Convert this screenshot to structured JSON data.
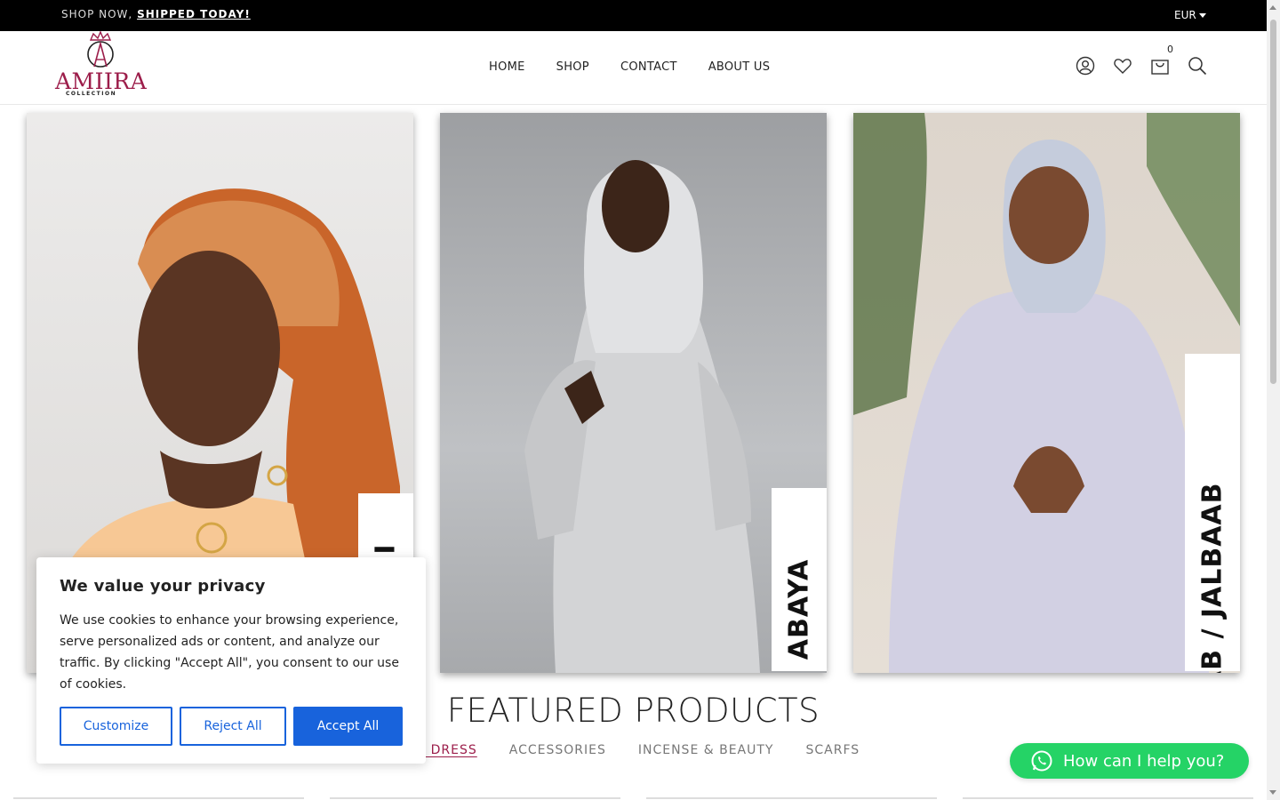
{
  "topbar": {
    "promo_prefix": "SHOP NOW, ",
    "promo_link": "SHIPPED TODAY!",
    "currency": "EUR"
  },
  "logo": {
    "brand": "AMIIRA",
    "sub": "COLLECTION",
    "brand_color": "#9c1d4a"
  },
  "nav": {
    "items": [
      "HOME",
      "SHOP",
      "CONTACT",
      "ABOUT US"
    ]
  },
  "header_icons": {
    "account": "user-icon",
    "wishlist": "heart-icon",
    "cart": "cart-icon",
    "search": "search-icon",
    "cart_count": "0"
  },
  "categories": [
    {
      "label": "GUNTIINO / DIRAC / SHAASH / BAATI",
      "visible_text": "I"
    },
    {
      "label": "ABAYA"
    },
    {
      "label": "HIJAB / JALBAAB"
    }
  ],
  "featured": {
    "title": "FEATURED PRODUCTS",
    "tabs": [
      "ATI DRESS",
      "ACCESSORIES",
      "INCENSE & BEAUTY",
      "SCARFS"
    ],
    "active_tab": 0
  },
  "cookie": {
    "title": "We value your privacy",
    "body": "We use cookies to enhance your browsing experience, serve personalized ads or content, and analyze our traffic. By clicking \"Accept All\", you consent to our use of cookies.",
    "customize": "Customize",
    "reject": "Reject All",
    "accept": "Accept All",
    "accent_color": "#1863dc"
  },
  "whatsapp": {
    "label": "How can I help you?",
    "color": "#25d366"
  }
}
